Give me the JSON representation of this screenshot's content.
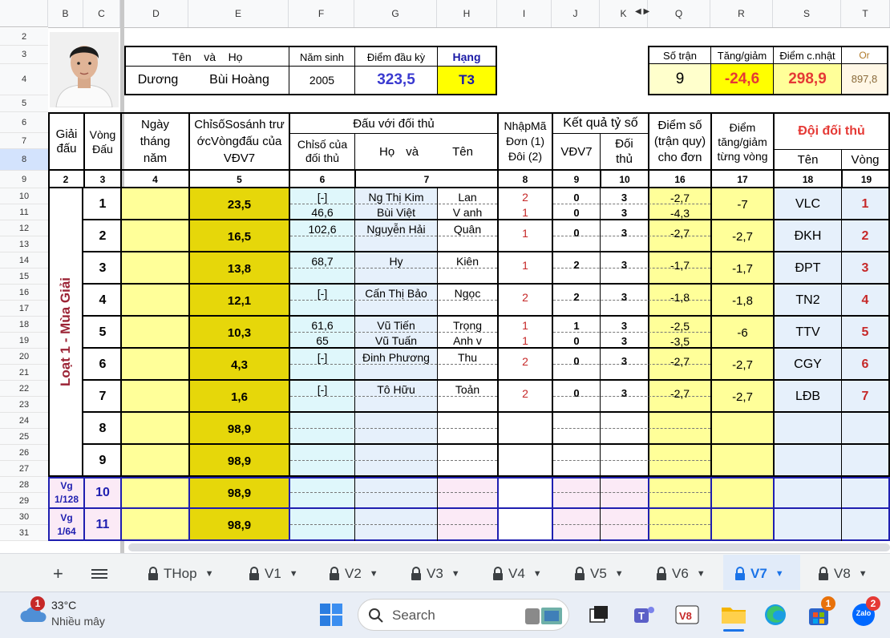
{
  "sheet": {
    "columns": [
      "B",
      "C",
      "D",
      "E",
      "F",
      "G",
      "H",
      "I",
      "J",
      "K",
      "Q",
      "R",
      "S",
      "T"
    ],
    "rows": [
      "2",
      "3",
      "4",
      "5",
      "6",
      "7",
      "8",
      "9",
      "10",
      "11",
      "12",
      "13",
      "14",
      "15",
      "16",
      "17",
      "18",
      "19",
      "20",
      "21",
      "22",
      "23",
      "24",
      "25",
      "26",
      "27",
      "28",
      "29",
      "30",
      "31"
    ],
    "player": {
      "ten_label": "Tên",
      "va_label": "và",
      "ho_label": "Họ",
      "nam_sinh_label": "Năm sinh",
      "diem_dau_ky_label": "Điểm đầu kỳ",
      "hang_label": "Hạng",
      "ten": "Dương",
      "ho": "Bùi Hoàng",
      "nam_sinh": "2005",
      "diem_dau_ky": "323,5",
      "hang": "T3"
    },
    "summary": {
      "so_tran_label": "Số trận",
      "tang_giam_label": "Tăng/giảm",
      "diem_cnhat_label": "Điểm c.nhật",
      "or_label": "Or",
      "so_tran": "9",
      "tang_giam": "-24,6",
      "diem_cnhat": "298,9",
      "or": "897,8"
    },
    "headers": {
      "giai_dau": "Giải đấu",
      "vong_dau": "Vòng Đấu",
      "ngay": "Ngày tháng năm",
      "chiso": "ChỉsốSosánh trướcVòngđấu của VĐV7",
      "dau_voi": "Đấu với đối thủ",
      "chiso_doithu": "Chỉsố của đối thủ",
      "ho": "Họ",
      "va": "và",
      "ten": "Tên",
      "nhapma": "NhậpMã Đơn (1) Đôi (2)",
      "ketqua": "Kết quả tỷ số",
      "vdv7": "VĐV7",
      "doithu": "Đối thủ",
      "diemso": "Điểm số (trận quy) cho đơn",
      "diemtg": "Điểm tăng/giảm từng vòng",
      "doidoithu": "Đội đối thủ",
      "doi_ten": "Tên",
      "doi_vong": "Vòng"
    },
    "index_row": [
      "2",
      "3",
      "4",
      "5",
      "6",
      "7",
      "8",
      "9",
      "10",
      "16",
      "17",
      "18",
      "19"
    ],
    "loat_label": "Loạt 1 - Mùa Giải",
    "rounds": [
      {
        "vong": "1",
        "chiso": "23,5",
        "lines": [
          {
            "cs": "[-]",
            "ho": "Ng Thị Kim",
            "ten": "Lan",
            "ma": "2",
            "v": "0",
            "d": "3",
            "ds": "-2,7"
          },
          {
            "cs": "46,6",
            "ho": "Bùi Việt",
            "ten": "V anh",
            "ma": "1",
            "v": "0",
            "d": "3",
            "ds": "-4,3"
          }
        ],
        "tg": "-7",
        "team": "VLC",
        "tv": "1"
      },
      {
        "vong": "2",
        "chiso": "16,5",
        "lines": [
          {
            "cs": "102,6",
            "ho": "Nguyễn Hải",
            "ten": "Quân",
            "ma": "1",
            "v": "0",
            "d": "3",
            "ds": "-2,7"
          }
        ],
        "tg": "-2,7",
        "team": "ĐKH",
        "tv": "2"
      },
      {
        "vong": "3",
        "chiso": "13,8",
        "lines": [
          {
            "cs": "68,7",
            "ho": "Hy",
            "ten": "Kiên",
            "ma": "1",
            "v": "2",
            "d": "3",
            "ds": "-1,7"
          }
        ],
        "tg": "-1,7",
        "team": "ĐPT",
        "tv": "3"
      },
      {
        "vong": "4",
        "chiso": "12,1",
        "lines": [
          {
            "cs": "[-]",
            "ho": "Cấn Thị Bảo",
            "ten": "Ngọc",
            "ma": "2",
            "v": "2",
            "d": "3",
            "ds": "-1,8"
          }
        ],
        "tg": "-1,8",
        "team": "TN2",
        "tv": "4"
      },
      {
        "vong": "5",
        "chiso": "10,3",
        "lines": [
          {
            "cs": "61,6",
            "ho": "Vũ Tiến",
            "ten": "Trọng",
            "ma": "1",
            "v": "1",
            "d": "3",
            "ds": "-2,5"
          },
          {
            "cs": "65",
            "ho": "Vũ Tuấn",
            "ten": "Anh v",
            "ma": "1",
            "v": "0",
            "d": "3",
            "ds": "-3,5"
          }
        ],
        "tg": "-6",
        "team": "TTV",
        "tv": "5"
      },
      {
        "vong": "6",
        "chiso": "4,3",
        "lines": [
          {
            "cs": "[-]",
            "ho": "Đinh Phương",
            "ten": "Thu",
            "ma": "2",
            "v": "0",
            "d": "3",
            "ds": "-2,7"
          }
        ],
        "tg": "-2,7",
        "team": "CGY",
        "tv": "6"
      },
      {
        "vong": "7",
        "chiso": "1,6",
        "lines": [
          {
            "cs": "[-]",
            "ho": "Tô Hữu",
            "ten": "Toản",
            "ma": "2",
            "v": "0",
            "d": "3",
            "ds": "-2,7"
          }
        ],
        "tg": "-2,7",
        "team": "LĐB",
        "tv": "7"
      },
      {
        "vong": "8",
        "chiso": "98,9",
        "lines": [],
        "tg": "",
        "team": "",
        "tv": ""
      },
      {
        "vong": "9",
        "chiso": "98,9",
        "lines": [],
        "tg": "",
        "team": "",
        "tv": ""
      },
      {
        "vong": "10",
        "chiso": "98,9",
        "lines": [],
        "tg": "",
        "team": "",
        "tv": "",
        "giai": "Vg 1/128"
      },
      {
        "vong": "11",
        "chiso": "98,9",
        "lines": [],
        "tg": "",
        "team": "",
        "tv": "",
        "giai": "Vg 1/64"
      }
    ]
  },
  "tabs": [
    "THop",
    "V1",
    "V2",
    "V3",
    "V4",
    "V5",
    "V6",
    "V7",
    "V8"
  ],
  "active_tab": "V7",
  "taskbar": {
    "weather_temp": "33°C",
    "weather_desc": "Nhiều mây",
    "weather_badge": "1",
    "search_placeholder": "Search",
    "store_badge": "1",
    "zalo_badge": "2",
    "zalo_label": "Zalo"
  },
  "colors": {
    "yellow": "#ffff99",
    "olive": "#e6d70a",
    "cyan": "#dff7fb",
    "lightblue": "#e6f0fb",
    "pink": "#fbeaf6",
    "accent": "#1a73e8"
  }
}
